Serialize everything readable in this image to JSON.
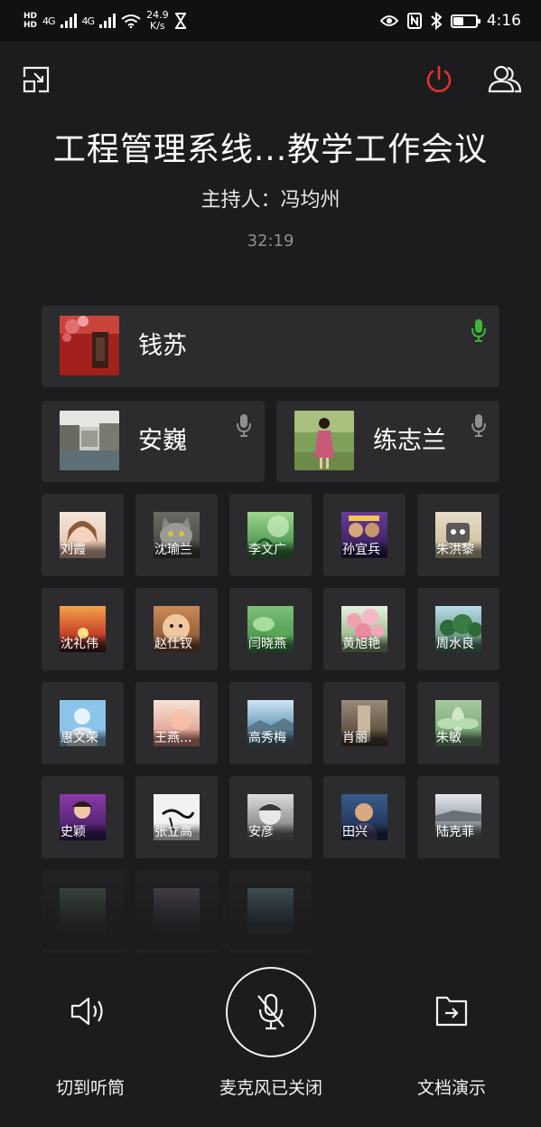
{
  "status_bar": {
    "hd1": "HD",
    "hd2": "HD",
    "network1": "4G",
    "network2": "4G",
    "speed_value": "24.9",
    "speed_unit": "K/s",
    "time": "4:16",
    "battery_level": 0.45
  },
  "meeting": {
    "title": "工程管理系线...教学工作会议",
    "host": "主持人：冯均州",
    "elapsed": "32:19"
  },
  "speakers": [
    {
      "name": "钱苏",
      "mic": "active",
      "mic_color": "#3cb534"
    },
    {
      "name": "安巍",
      "mic": "idle",
      "mic_color": "#8e8e93"
    },
    {
      "name": "练志兰",
      "mic": "idle",
      "mic_color": "#8e8e93"
    }
  ],
  "participants": [
    "刘霞",
    "沈瑜兰",
    "李文广",
    "孙宜兵",
    "朱洪黎",
    "沈礼伟",
    "赵仕钗",
    "闫晓燕",
    "黄旭艳",
    "周水良",
    "惠文荣",
    "王燕...",
    "高秀梅",
    "肖丽",
    "朱敏",
    "史颖",
    "张立高",
    "安彦",
    "田兴",
    "陆克菲"
  ],
  "controls": {
    "speaker_label": "切到听筒",
    "mic_label": "麦克风已关闭",
    "doc_label": "文档演示"
  },
  "colors": {
    "background": "#1c1c1e",
    "tile": "#2c2c2e",
    "leave_red": "#e0332e",
    "mic_active": "#3cb534"
  }
}
